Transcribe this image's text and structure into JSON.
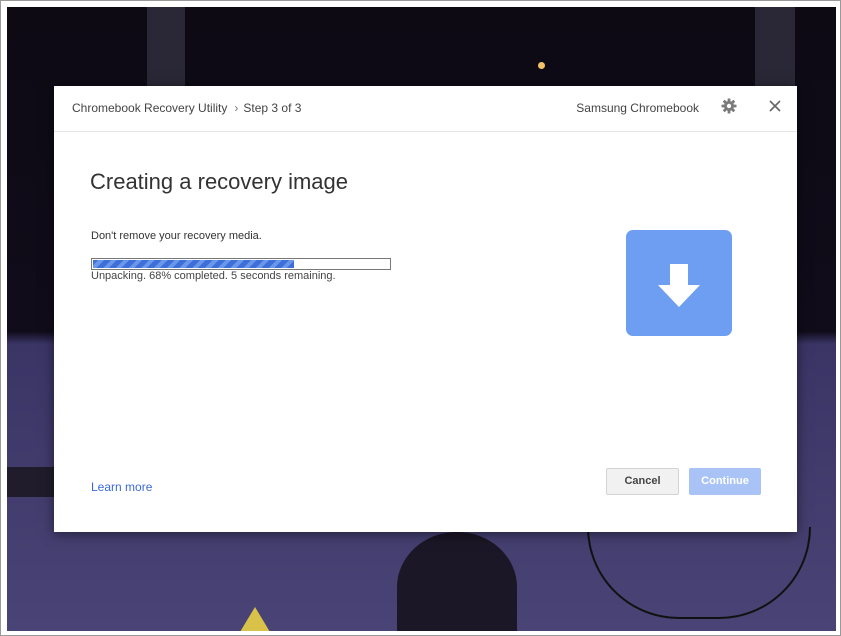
{
  "header": {
    "app_name": "Chromebook Recovery Utility",
    "separator": "›",
    "step": "Step 3 of 3",
    "device": "Samsung Chromebook",
    "settings_icon": "gear-icon",
    "close_icon": "close-icon"
  },
  "main": {
    "title": "Creating a recovery image",
    "instruction": "Don't remove your recovery media.",
    "progress_fraction": 0.68,
    "status": "Unpacking. 68% completed. 5 seconds remaining.",
    "illustration_icon": "download-arrow-icon"
  },
  "footer": {
    "learn_more": "Learn more",
    "cancel_label": "Cancel",
    "continue_label": "Continue"
  },
  "colors": {
    "accent": "#6d9ef2",
    "progress": "#3c6fd8",
    "link": "#3b6ad8",
    "continue_disabled": "#a9c3f6"
  }
}
